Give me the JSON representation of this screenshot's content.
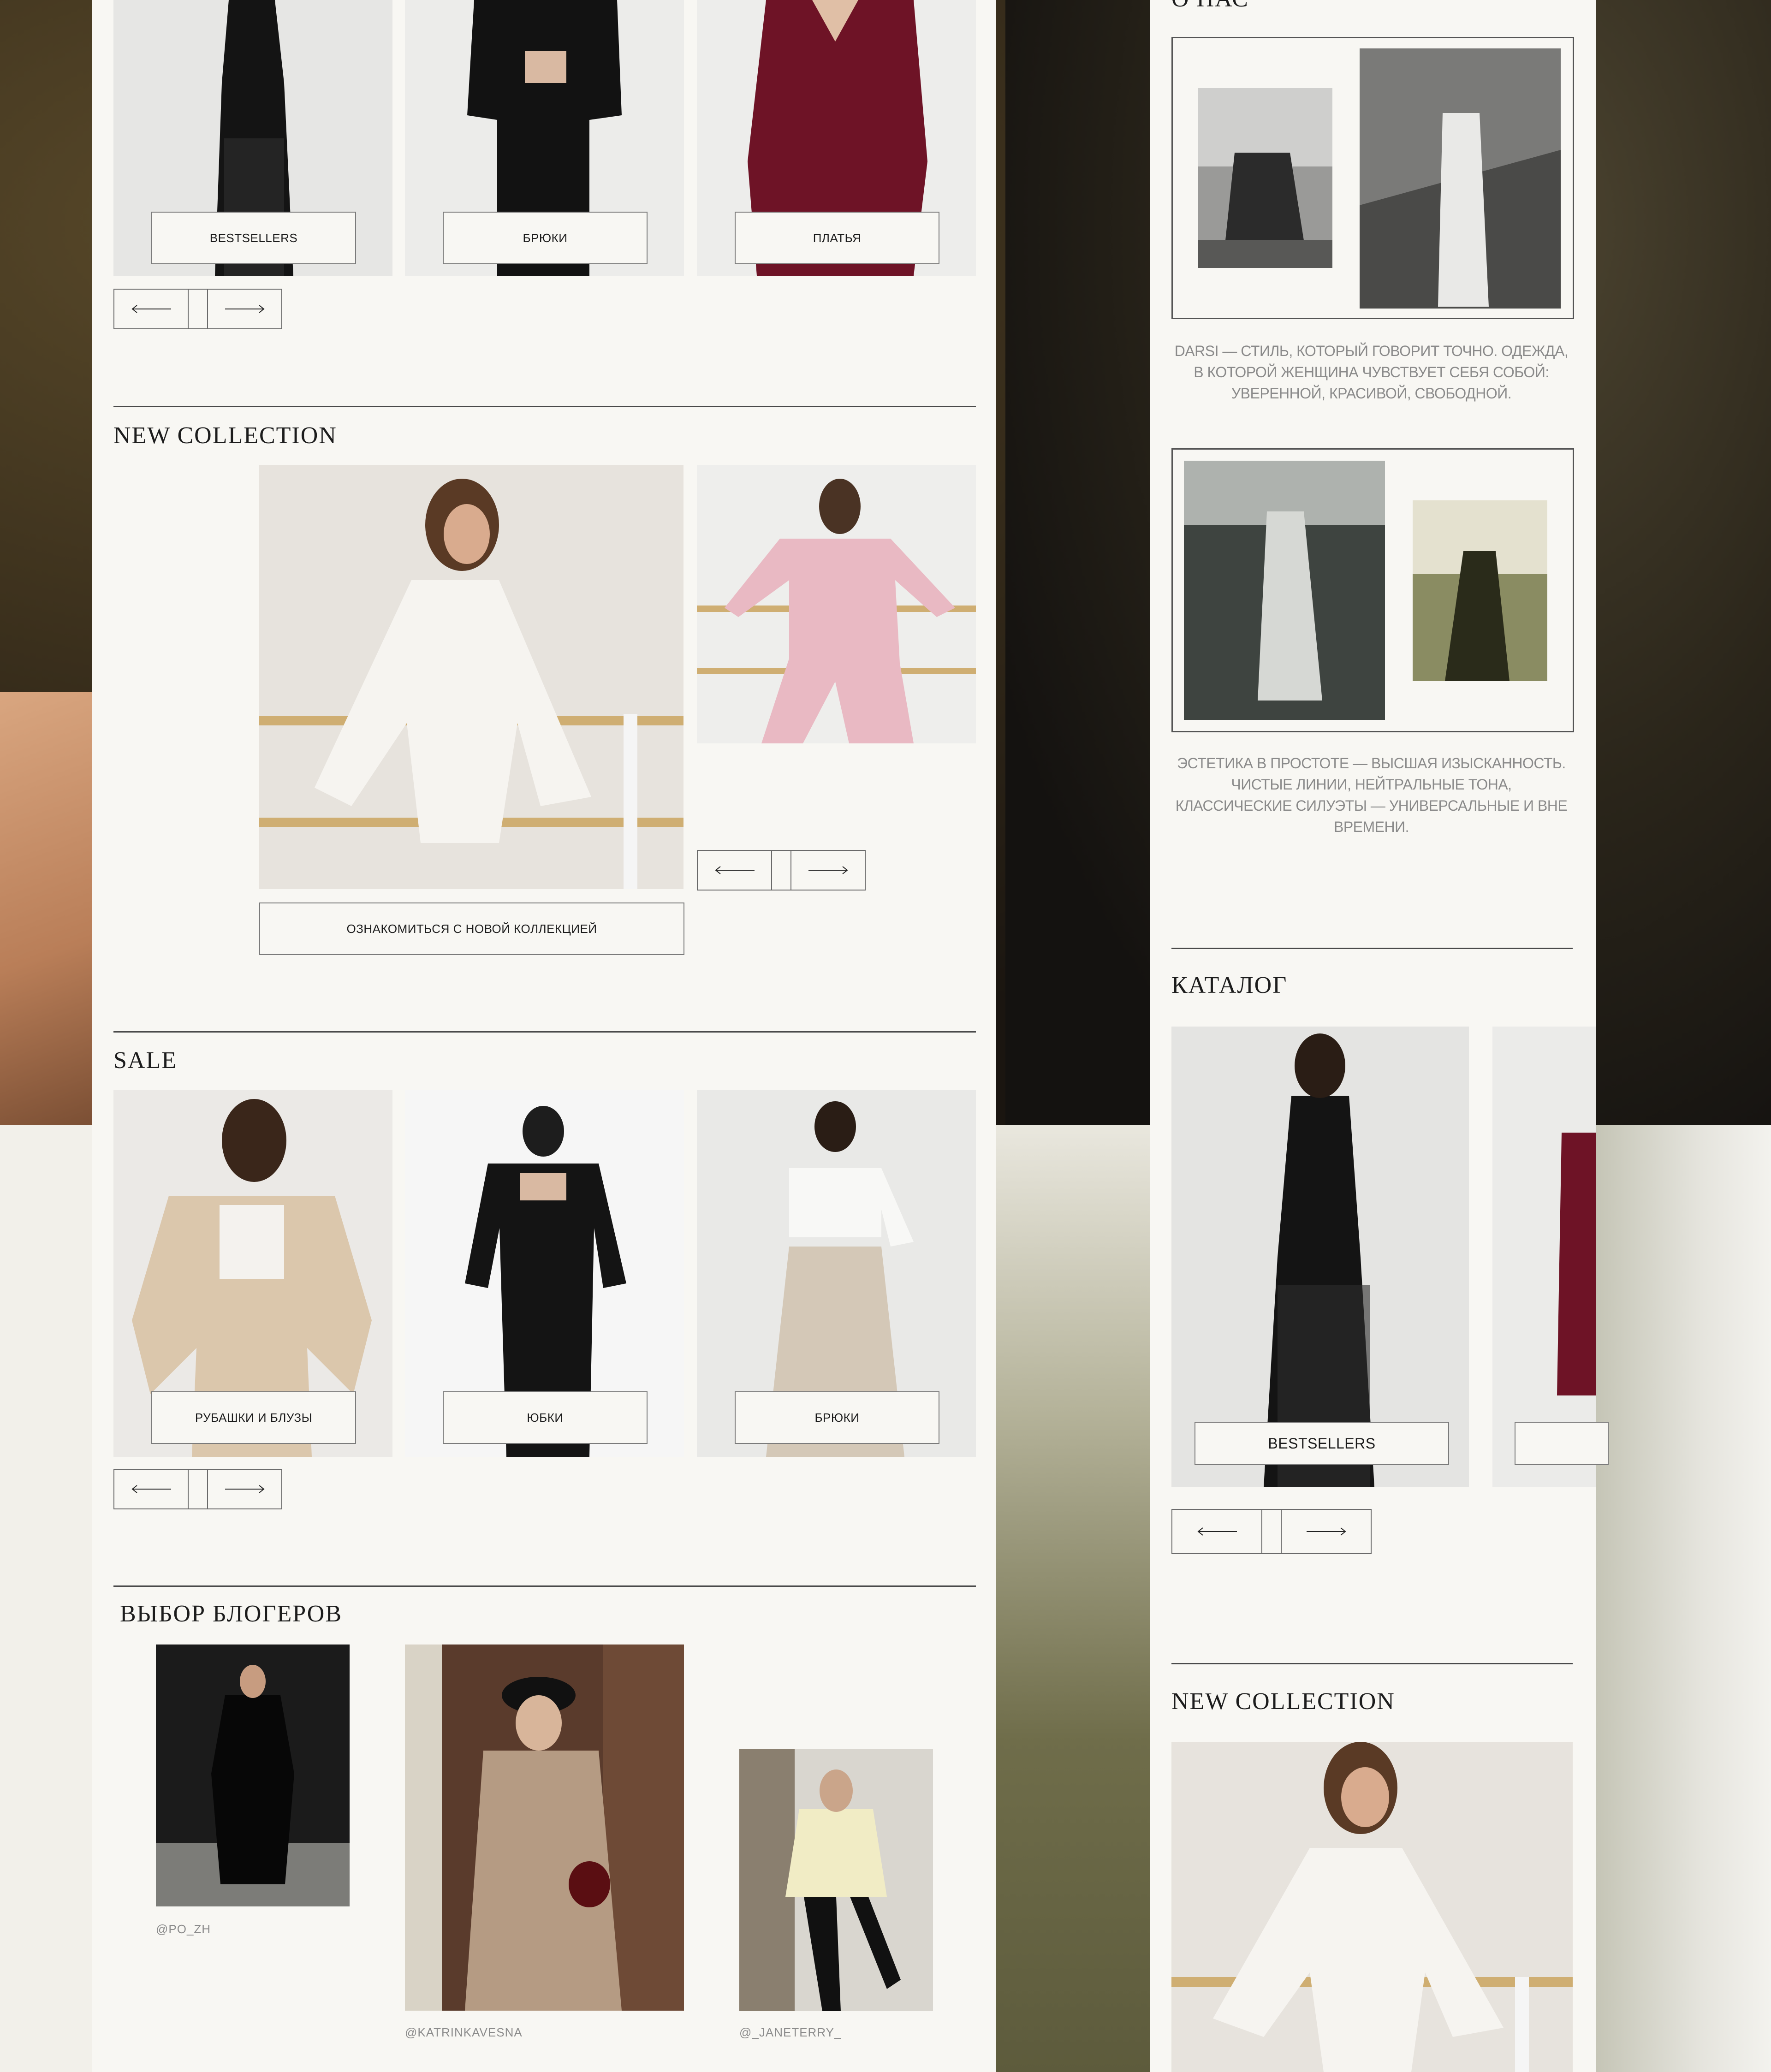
{
  "left_panel": {
    "top_row": {
      "labels": [
        "BESTSELLERS",
        "БРЮКИ",
        "ПЛАТЬЯ"
      ]
    },
    "new_collection": {
      "title": "NEW COLLECTION",
      "cta_label": "ОЗНАКОМИТЬСЯ С НОВОЙ КОЛЛЕКЦИЕЙ"
    },
    "sale": {
      "title": "SALE",
      "labels": [
        "РУБАШКИ И БЛУЗЫ",
        "ЮБКИ",
        "БРЮКИ"
      ]
    },
    "bloggers": {
      "title": "ВЫБОР БЛОГЕРОВ",
      "handles": [
        "@PO_ZH",
        "@KATRINKAVESNA",
        "@_JANETERRY_"
      ]
    }
  },
  "right_panel": {
    "about": {
      "title": "О НАС",
      "text_1": "DARSI — СТИЛЬ, КОТОРЫЙ ГОВОРИТ ТОЧНО. ОДЕЖДА, В КОТОРОЙ ЖЕНЩИНА ЧУВСТВУЕТ СЕБЯ СОБОЙ: УВЕРЕННОЙ, КРАСИВОЙ, СВОБОДНОЙ.",
      "text_2": "ЭСТЕТИКА В ПРОСТОТЕ — ВЫСШАЯ ИЗЫСКАННОСТЬ. ЧИСТЫЕ ЛИНИИ, НЕЙТРАЛЬНЫЕ ТОНА, КЛАССИЧЕСКИЕ СИЛУЭТЫ — УНИВЕРСАЛЬНЫЕ И ВНЕ ВРЕМЕНИ."
    },
    "catalog": {
      "title": "КАТАЛОГ",
      "label": "BESTSELLERS"
    },
    "new_collection": {
      "title": "NEW COLLECTION"
    }
  },
  "colors": {
    "panel_bg": "#f8f7f3",
    "border": "#6a6a6a",
    "text_dark": "#1c1c1c",
    "text_muted": "#8a8a8a",
    "burgundy": "#6e1326",
    "pink": "#e9b9c3"
  },
  "icons": [
    "arrow-left-icon",
    "arrow-right-icon"
  ]
}
